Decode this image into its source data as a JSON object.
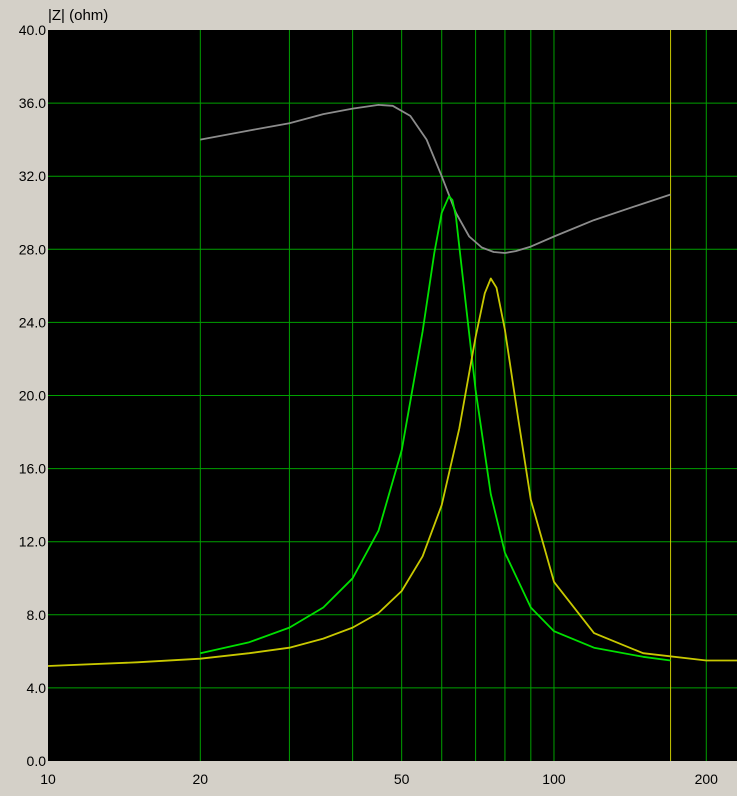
{
  "chart_data": {
    "type": "line",
    "title": "",
    "ylabel": "|Z| (ohm)",
    "xlabel": "",
    "x_scale": "log",
    "xlim": [
      10,
      230
    ],
    "ylim": [
      0,
      40
    ],
    "grid": true,
    "y_ticks": [
      "0.0",
      "4.0",
      "8.0",
      "12.0",
      "16.0",
      "20.0",
      "24.0",
      "28.0",
      "32.0",
      "36.0",
      "40.0"
    ],
    "x_ticks": [
      {
        "value": 10,
        "label": "10"
      },
      {
        "value": 20,
        "label": "20"
      },
      {
        "value": 50,
        "label": "50"
      },
      {
        "value": 100,
        "label": "100"
      },
      {
        "value": 200,
        "label": "200"
      }
    ],
    "x_gridlines": [
      20,
      30,
      40,
      50,
      60,
      70,
      80,
      90,
      100,
      200
    ],
    "marker_line": {
      "x": 170,
      "color": "#c8c800"
    },
    "colors": {
      "background": "#000000",
      "frame": "#d4d0c8",
      "grid": "#00a000"
    },
    "series": [
      {
        "color": "#8c8c8c",
        "x": [
          20,
          25,
          30,
          35,
          40,
          45,
          48,
          52,
          56,
          60,
          64,
          68,
          72,
          76,
          80,
          84,
          90,
          100,
          120,
          150,
          170
        ],
        "y": [
          34.0,
          34.5,
          34.9,
          35.4,
          35.7,
          35.9,
          35.85,
          35.3,
          34.0,
          32.0,
          30.0,
          28.7,
          28.1,
          27.85,
          27.8,
          27.9,
          28.15,
          28.7,
          29.6,
          30.5,
          31.0
        ]
      },
      {
        "color": "#00e000",
        "x": [
          20,
          25,
          30,
          35,
          40,
          45,
          50,
          55,
          58,
          60,
          62,
          63,
          64,
          66,
          70,
          75,
          80,
          90,
          100,
          120,
          150,
          170
        ],
        "y": [
          5.9,
          6.5,
          7.3,
          8.4,
          10.0,
          12.6,
          17.0,
          23.5,
          27.8,
          30.0,
          30.9,
          30.7,
          29.8,
          26.5,
          20.3,
          14.6,
          11.4,
          8.4,
          7.1,
          6.2,
          5.7,
          5.5
        ]
      },
      {
        "color": "#c8c800",
        "x": [
          10,
          15,
          20,
          25,
          30,
          35,
          40,
          45,
          50,
          55,
          60,
          65,
          70,
          73,
          75,
          77,
          80,
          85,
          90,
          100,
          120,
          150,
          200,
          230
        ],
        "y": [
          5.2,
          5.4,
          5.6,
          5.9,
          6.2,
          6.7,
          7.3,
          8.1,
          9.3,
          11.2,
          14.0,
          18.2,
          23.2,
          25.6,
          26.4,
          25.9,
          23.6,
          18.7,
          14.3,
          9.8,
          7.0,
          5.9,
          5.5,
          5.5
        ]
      }
    ]
  }
}
